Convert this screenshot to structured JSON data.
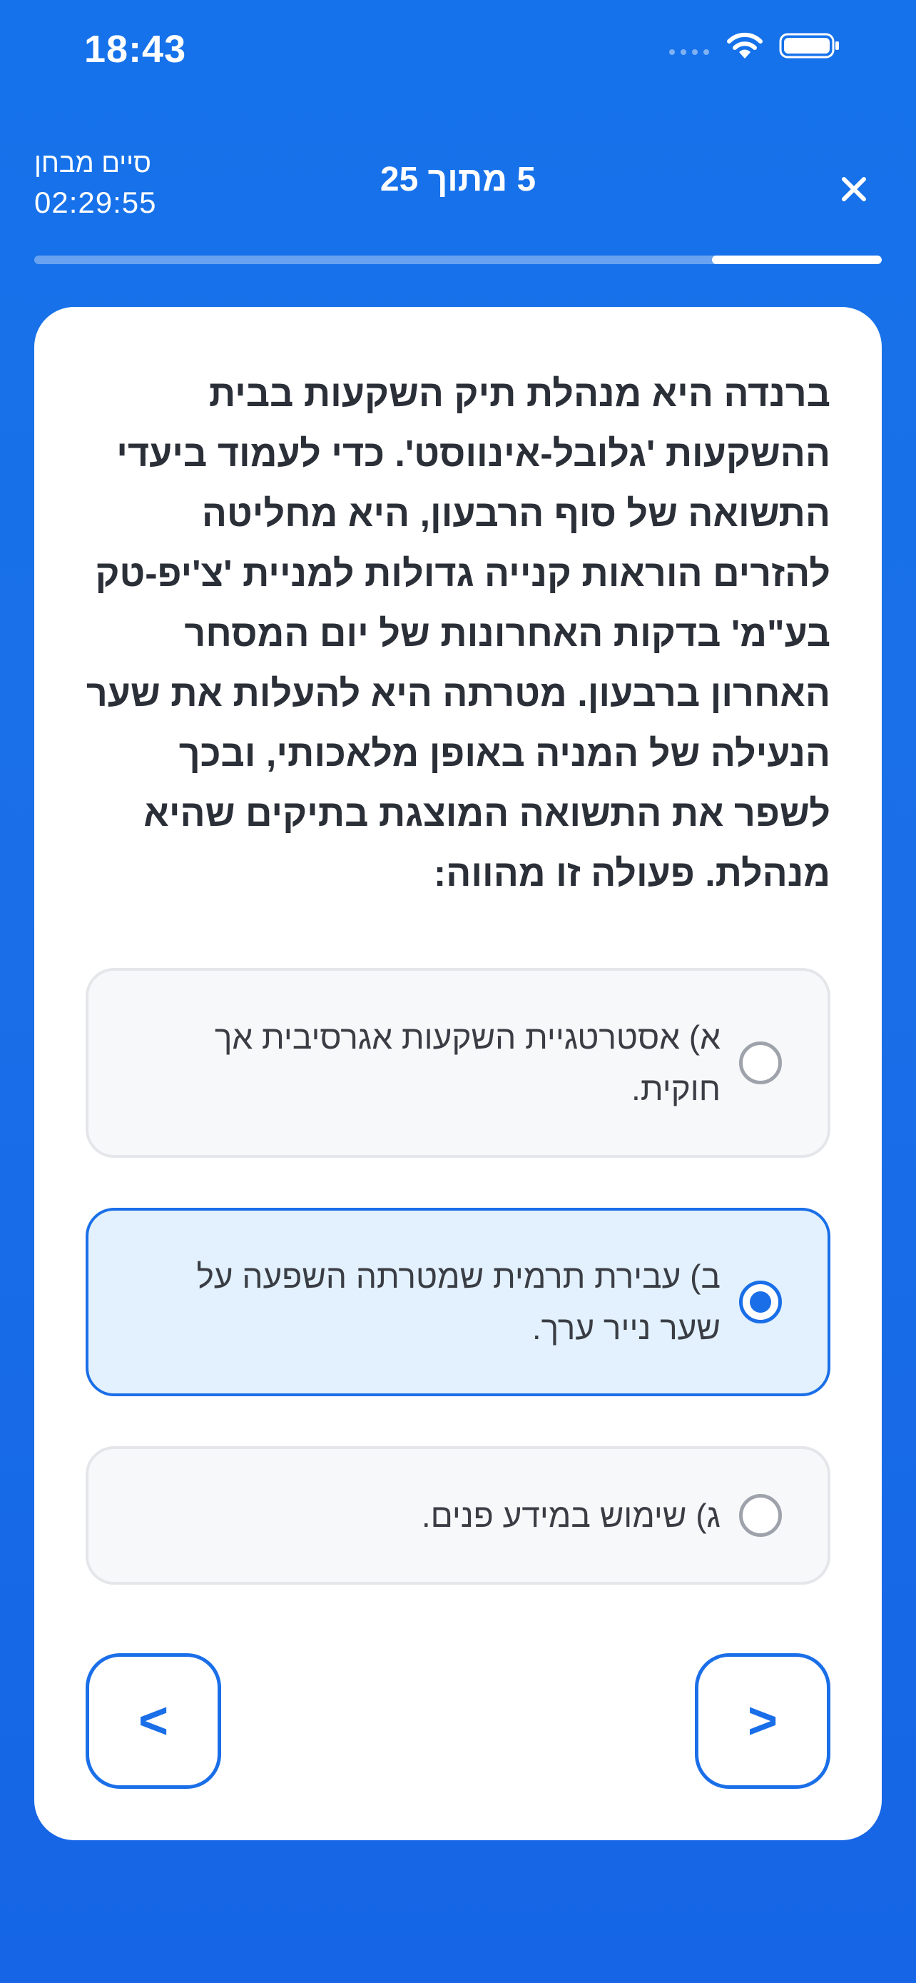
{
  "status_bar": {
    "time": "18:43"
  },
  "header": {
    "finish_label": "סיים מבחן",
    "timer": "02:29:55",
    "progress_text": "5 מתוך 25",
    "progress_fraction": 0.2,
    "close_glyph": "×"
  },
  "question": {
    "text": "ברנדה היא מנהלת תיק השקעות בבית ההשקעות 'גלובל-אינווסט'. כדי לעמוד ביעדי התשואה של סוף הרבעון, היא מחליטה להזרים הוראות קנייה גדולות למניית 'צ'יפ-טק בע\"מ' בדקות האחרונות של יום המסחר האחרון ברבעון. מטרתה היא להעלות את שער הנעילה של המניה באופן מלאכותי, ובכך לשפר את התשואה המוצגת בתיקים שהיא מנהלת. פעולה זו מהווה:"
  },
  "options": [
    {
      "text": "א) אסטרטגיית השקעות אגרסיבית אך חוקית.",
      "selected": false
    },
    {
      "text": "ב) עבירת תרמית שמטרתה השפעה על שער נייר ערך.",
      "selected": true
    },
    {
      "text": "ג) שימוש במידע פנים.",
      "selected": false
    }
  ],
  "navigation": {
    "prev_label": "<",
    "next_label": ">"
  },
  "colors": {
    "primary": "#1A6FE8",
    "selected_bg": "#E2F1FD",
    "option_bg": "#F7F8FA"
  }
}
